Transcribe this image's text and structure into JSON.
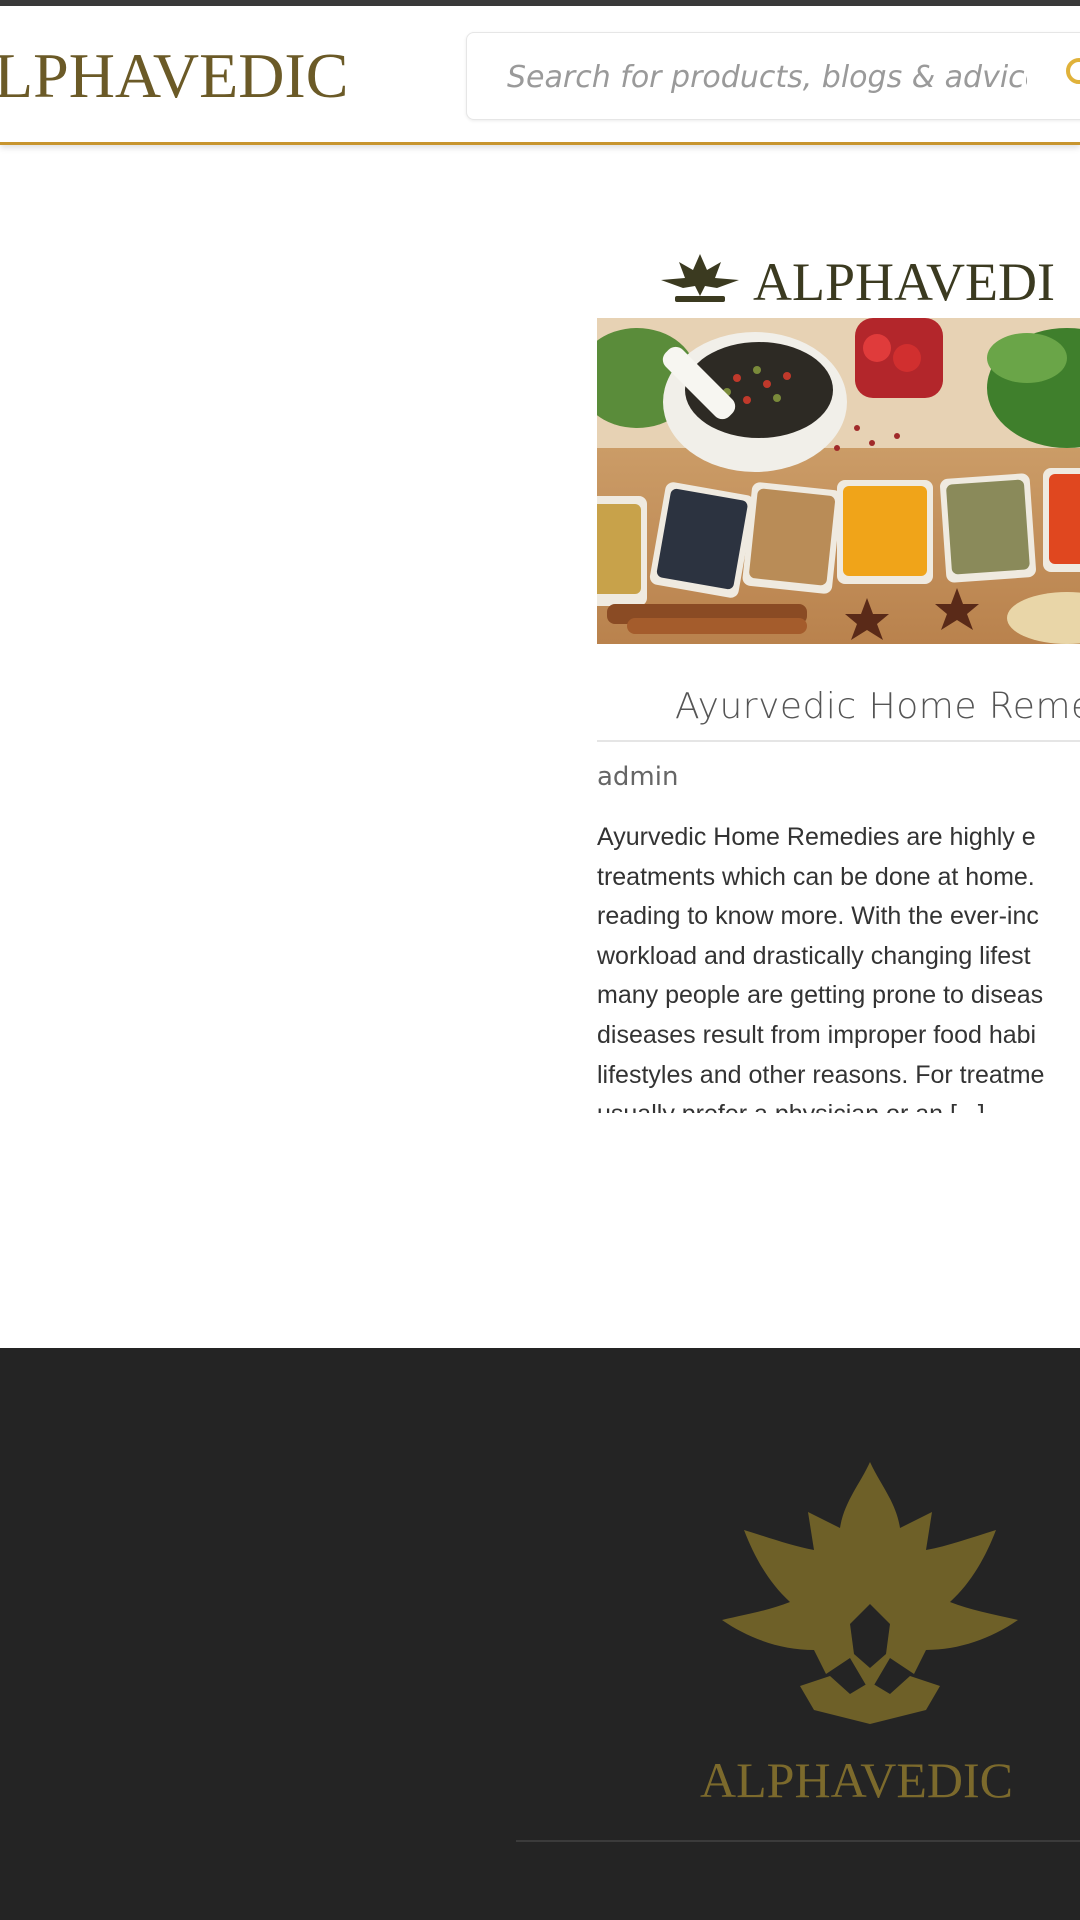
{
  "header": {
    "brand": "LPHAVEDIC",
    "search_placeholder": "Search for products, blogs & advices"
  },
  "post": {
    "logo_text": "ALPHAVEDI",
    "title": "Ayurvedic Home Reme",
    "author": "admin",
    "excerpt_lines": [
      "Ayurvedic Home Remedies are highly e",
      "treatments which can be done at home.",
      "reading to know more. With the ever-inc",
      "workload and drastically changing lifest",
      "many people are getting prone to diseas",
      "diseases result from improper food habi",
      "lifestyles and other reasons. For treatme",
      "usually prefer a physician or an [...]"
    ]
  },
  "footer": {
    "brand": "ALPHAVEDIC"
  },
  "colors": {
    "accent": "#c8952e",
    "brand_olive": "#6b5a27",
    "footer_bg": "#242424"
  },
  "icons": {
    "search": "search-icon",
    "leaf_logo": "leaf-logo-icon"
  }
}
